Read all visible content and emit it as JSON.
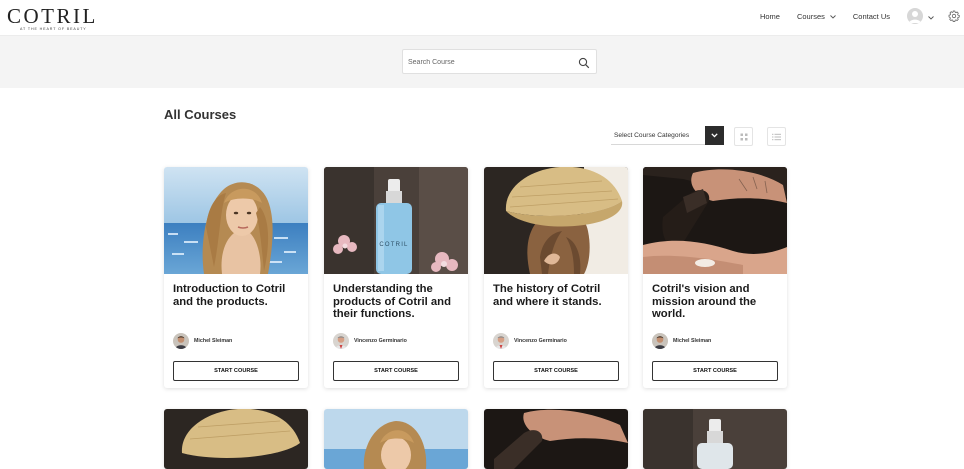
{
  "brand": {
    "name": "COTRIL",
    "tagline": "AT THE HEART OF BEAUTY"
  },
  "nav": {
    "home": "Home",
    "courses": "Courses",
    "contact": "Contact Us"
  },
  "search": {
    "placeholder": "Search Course"
  },
  "page": {
    "title": "All Courses"
  },
  "filter": {
    "label": "Select Course Categories"
  },
  "courses": [
    {
      "title": "Introduction to Cotril and the products.",
      "author": "Michel Sleiman",
      "button": "START COURSE",
      "image": "woman-beach-photo"
    },
    {
      "title": "Understanding the products of Cotril and their functions.",
      "author": "Vincenzo Germinario",
      "button": "START COURSE",
      "image": "cotril-bottle-photo"
    },
    {
      "title": "The history of Cotril and where it stands.",
      "author": "Vincenzo Germinario",
      "button": "START COURSE",
      "image": "straw-hat-photo"
    },
    {
      "title": "Cotril's vision and mission around the world.",
      "author": "Michel Sleiman",
      "button": "START COURSE",
      "image": "product-hands-photo"
    }
  ],
  "colors": {
    "accent": "#2c2c2c",
    "band": "#f4f4f4"
  }
}
